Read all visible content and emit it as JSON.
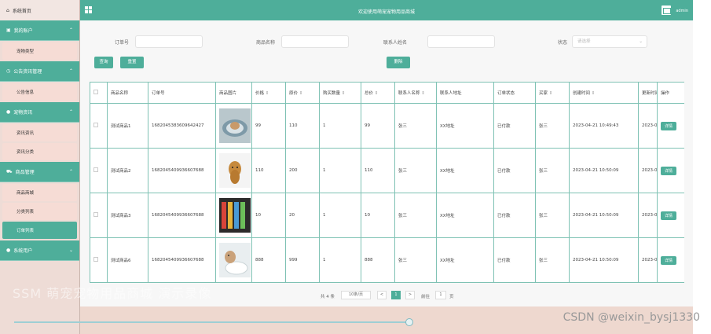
{
  "sidebar": {
    "home": "系统首页",
    "groups": [
      {
        "label": "我的账户"
      },
      {
        "label": "公告资讯管理"
      },
      {
        "label": "宠物资讯"
      },
      {
        "label": "商品管理"
      },
      {
        "label": "系统用户"
      }
    ],
    "subs": {
      "g0": [
        "宠物类型"
      ],
      "g1": [
        "公告信息"
      ],
      "g2": [
        "资讯资讯",
        "资讯分类"
      ],
      "g3": [
        "商品商城",
        "分类列表",
        "订单列表"
      ]
    }
  },
  "header": {
    "title": "欢迎使用萌宠宠物用品商城",
    "admin": "admin"
  },
  "search": {
    "order_label": "订单号",
    "product_label": "商品名称",
    "contact_label": "联系人姓名",
    "status_label": "状态",
    "status_placeholder": "请选择",
    "search_btn": "查询",
    "reset_btn": "重置",
    "delete_btn": "删除"
  },
  "table": {
    "headers": [
      "商品名称",
      "订单号",
      "商品图片",
      "价格",
      "原价",
      "购买数量",
      "总价",
      "联系人名称",
      "联系人地址",
      "订单状态",
      "买家",
      "创建时间",
      "更新时间",
      "操作"
    ],
    "rows": [
      [
        "测试商品1",
        "1682045383609642427",
        "dog-bed",
        "99",
        "110",
        "1",
        "99",
        "张三",
        "XX地址",
        "已付款",
        "张三",
        "2023-04-21 10:49:43",
        "2023-0",
        "详情"
      ],
      [
        "测试商品2",
        "1682045409936607688",
        "dog",
        "110",
        "200",
        "1",
        "110",
        "张三",
        "XX地址",
        "已付款",
        "张三",
        "2023-04-21 10:50:09",
        "2023-0",
        "详情"
      ],
      [
        "测试商品3",
        "1682045409936607688",
        "collars",
        "10",
        "20",
        "1",
        "10",
        "张三",
        "XX地址",
        "已付款",
        "张三",
        "2023-04-21 10:50:09",
        "2023-0",
        "详情"
      ],
      [
        "测试商品6",
        "1682045409936607688",
        "cat-fountain",
        "888",
        "999",
        "1",
        "888",
        "张三",
        "XX地址",
        "已付款",
        "张三",
        "2023-04-21 10:50:09",
        "2023-0",
        "详情"
      ]
    ]
  },
  "pagination": {
    "total": "共 4 条",
    "page_size": "10条/页",
    "prev": "<",
    "current": "1",
    "next": ">",
    "goto_label": "前往",
    "goto_value": "1",
    "unit": "页"
  },
  "overlay": {
    "video_watermark": "SSM 萌宠宠物用品商城 演示录像",
    "csdn": "CSDN @weixin_bysj1330"
  },
  "colors": {
    "accent": "#4eae9a",
    "sidebar_bg": "#eedcd6",
    "sub_item_bg": "#f6dcd5"
  }
}
